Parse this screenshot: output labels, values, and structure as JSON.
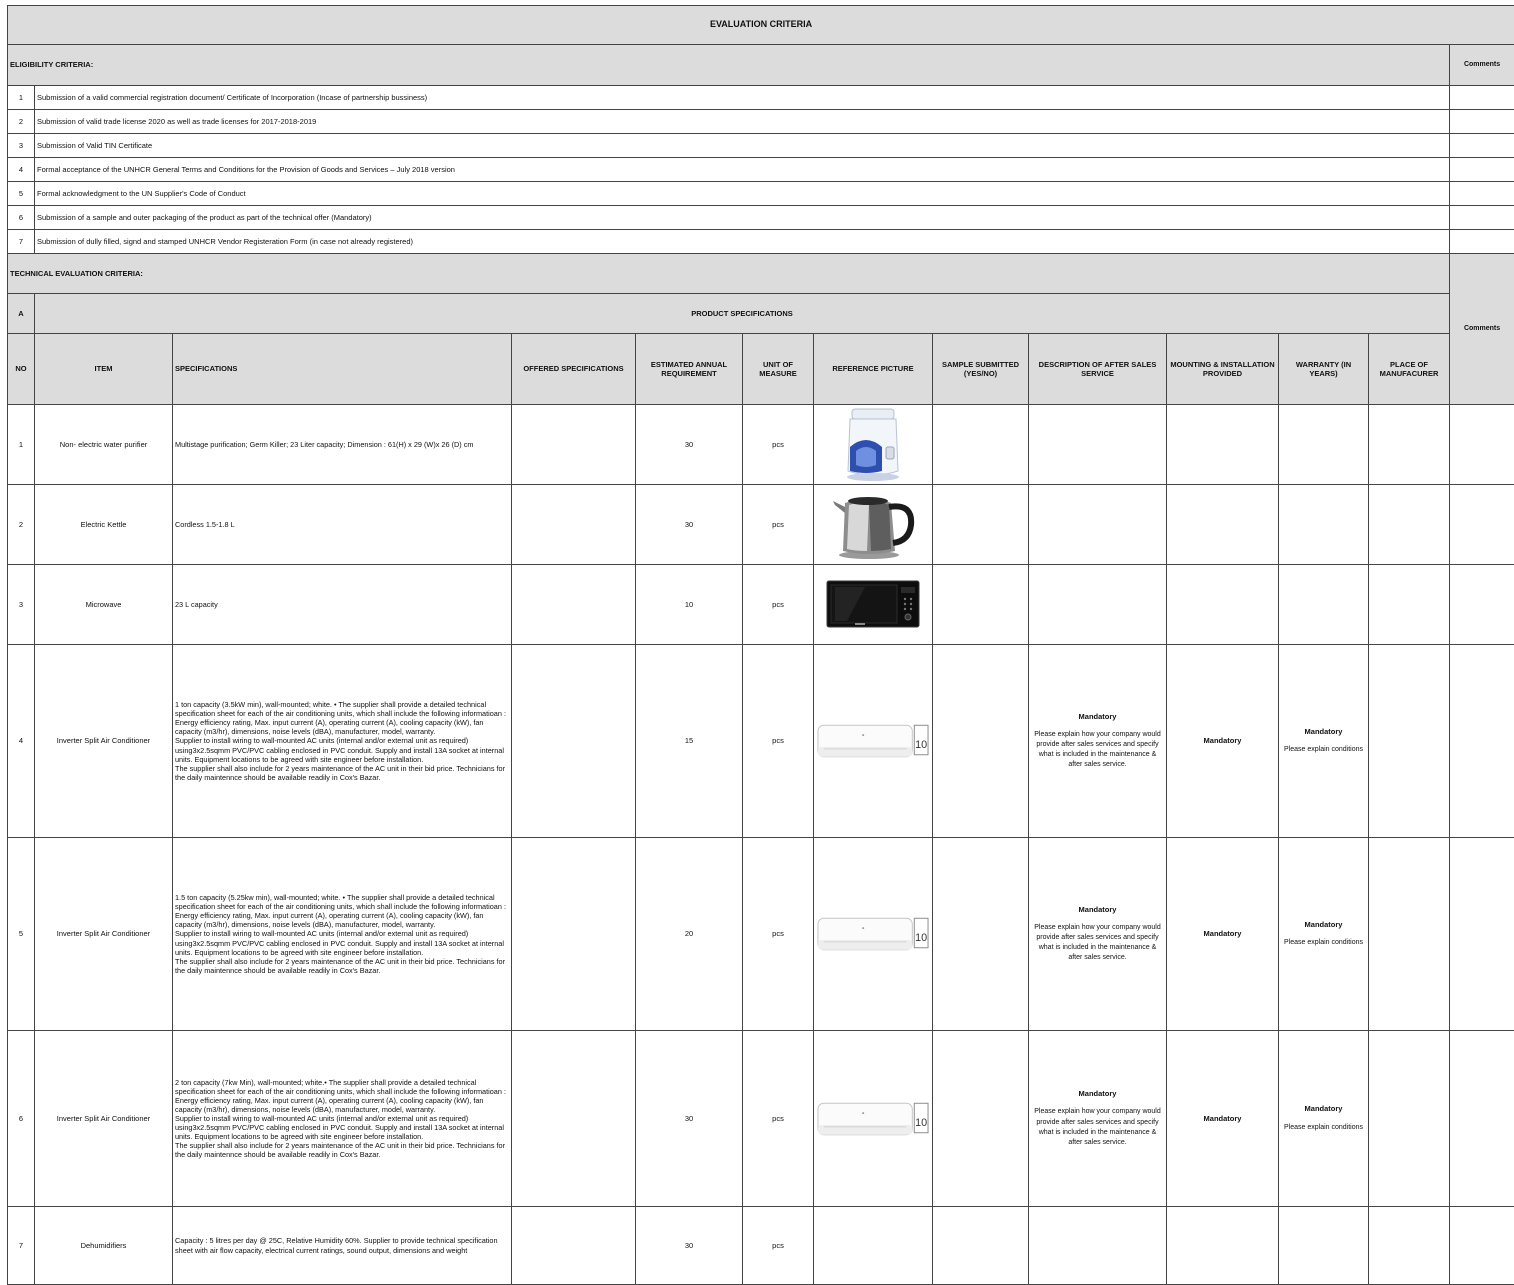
{
  "title": "EVALUATION CRITERIA",
  "eligibility": {
    "heading": "ELIGIBILITY CRITERIA:",
    "comments_label": "Comments",
    "items": [
      {
        "no": "1",
        "text": "Submission of a valid commercial registration document/ Certificate of Incorporation (Incase of partnership bussiness)"
      },
      {
        "no": "2",
        "text": "Submission of valid trade license 2020 as well as trade licenses for 2017-2018-2019"
      },
      {
        "no": "3",
        "text": "Submission of Valid TIN Certificate"
      },
      {
        "no": "4",
        "text": "Formal acceptance of the UNHCR General Terms and Conditions for the Provision of Goods and Services – July 2018 version"
      },
      {
        "no": "5",
        "text": "Formal acknowledgment to the UN Supplier's Code of Conduct"
      },
      {
        "no": "6",
        "text": "Submission of a sample and outer packaging of the product as part of the technical offer (Mandatory)"
      },
      {
        "no": "7",
        "text": "Submission of dully filled, signd and stamped UNHCR Vendor Registeration Form (in case not already registered)"
      }
    ]
  },
  "technical": {
    "heading": "TECHNICAL EVALUATION CRITERIA:",
    "section_letter": "A",
    "section_title": "PRODUCT SPECIFICATIONS",
    "comments_label": "Comments",
    "columns": {
      "no": "NO",
      "item": "ITEM",
      "specifications": "SPECIFICATIONS",
      "offered": "OFFERED SPECIFICATIONS",
      "annual": "ESTIMATED ANNUAL REQUIREMENT",
      "unit": "UNIT OF MEASURE",
      "picture": "REFERENCE PICTURE",
      "sample": "SAMPLE SUBMITTED (YES/NO)",
      "after_sales": "DESCRIPTION OF AFTER SALES SERVICE",
      "mounting": "MOUNTING & INSTALLATION PROVIDED",
      "warranty": "WARRANTY (IN YEARS)",
      "place": "PLACE OF MANUFACURER"
    },
    "rows": [
      {
        "no": "1",
        "item": "Non- electric water purifier",
        "spec": "Multistage purification; Germ Killer;  23 Liter capacity; Dimension : 61(H) x 29 (W)x 26 (D) cm",
        "qty": "30",
        "unit": "pcs",
        "picture_icon": "water-purifier-image"
      },
      {
        "no": "2",
        "item": "Electric Kettle",
        "spec": "Cordless 1.5-1.8 L",
        "qty": "30",
        "unit": "pcs",
        "picture_icon": "electric-kettle-image"
      },
      {
        "no": "3",
        "item": "Microwave",
        "spec": "23 L capacity",
        "qty": "10",
        "unit": "pcs",
        "picture_icon": "microwave-image"
      },
      {
        "no": "4",
        "item": "Inverter Split Air Conditioner",
        "spec": "1 ton capacity (3.5kW min), wall-mounted; white. • The supplier shall provide a detailed technical specification sheet for each of the air conditioning units, which shall include the following informatioan : Energy efficiency rating, Max. input current (A), operating current (A),  cooling capacity (kW), fan capacity (m3/hr), dimensions, noise levels (dBA), manufacturer, model, warranty.\nSupplier to install wiring to wall-mounted AC units (internal and/or external unit as required) using3x2.5sqmm PVC/PVC cabling enclosed in PVC conduit. Supply and install 13A socket at internal units. Equipment locations to be agreed with site engineer before installation.\nThe supplier shall also include for 2 years maintenance of the AC unit in their bid price. Technicians for the daily maintennce should be available readily in Cox's Bazar.",
        "qty": "15",
        "unit": "pcs",
        "picture_icon": "air-conditioner-image",
        "after_sales_head": "Mandatory",
        "after_sales_body": "Please explain how your company would provide after sales services and specify what is included in the maintenance & after sales service.",
        "mounting": "Mandatory",
        "warranty_head": "Mandatory",
        "warranty_body": "Please explain conditions"
      },
      {
        "no": "5",
        "item": "Inverter Split Air Conditioner",
        "spec": "1.5 ton capacity (5.25kw min), wall-mounted; white. • The supplier shall provide a detailed technical specification sheet for each of the air conditioning units, which shall include the following informatioan : Energy efficiency rating, Max. input current (A), operating current (A),  cooling capacity (kW), fan capacity (m3/hr), dimensions, noise levels (dBA), manufacturer, model, warranty.\nSupplier to install wiring to wall-mounted AC units (internal and/or external unit as required) using3x2.5sqmm PVC/PVC cabling enclosed in PVC conduit. Supply and install 13A socket at internal units. Equipment locations to be agreed with site engineer before installation.\nThe supplier shall also include for 2 years maintenance of the AC unit in their bid price. Technicians for the daily maintennce should be available readily in Cox's Bazar.",
        "qty": "20",
        "unit": "pcs",
        "picture_icon": "air-conditioner-image",
        "after_sales_head": "Mandatory",
        "after_sales_body": "Please explain how your company would provide after sales services and specify what is included in the maintenance & after sales service.",
        "mounting": "Mandatory",
        "warranty_head": "Mandatory",
        "warranty_body": "Please explain conditions"
      },
      {
        "no": "6",
        "item": "Inverter Split Air Conditioner",
        "spec": "2 ton capacity (7kw Min), wall-mounted; white.• The supplier shall provide a detailed technical specification sheet for each of the air conditioning units, which shall include the following informatioan : Energy efficiency rating, Max. input current (A), operating current (A),  cooling capacity (kW), fan capacity (m3/hr), dimensions, noise levels (dBA), manufacturer, model, warranty.\nSupplier to install wiring to wall-mounted AC units (internal and/or external unit as required) using3x2.5sqmm PVC/PVC cabling enclosed in PVC conduit. Supply and install 13A socket at internal units. Equipment locations to be agreed with site engineer before installation.\nThe supplier shall also include for 2 years maintenance of the AC unit in their bid price. Technicians for the daily maintennce should be available readily in Cox's Bazar.",
        "qty": "30",
        "unit": "pcs",
        "picture_icon": "air-conditioner-image",
        "after_sales_head": "Mandatory",
        "after_sales_body": "Please explain how your company would provide after sales services and specify what is included in the maintenance & after sales service.",
        "mounting": "Mandatory",
        "warranty_head": "Mandatory",
        "warranty_body": "Please explain conditions"
      },
      {
        "no": "7",
        "item": "Dehumidifiers",
        "spec": "Capacity : 5 litres per day @ 25C, Relative Humidity 60%. Supplier to provide technical specification sheet with air flow capacity, electrical current ratings, sound output, dimensions and weight",
        "qty": "30",
        "unit": "pcs"
      }
    ]
  },
  "colors": {
    "header_gray": "#dcdcdc",
    "border": "#444444"
  }
}
